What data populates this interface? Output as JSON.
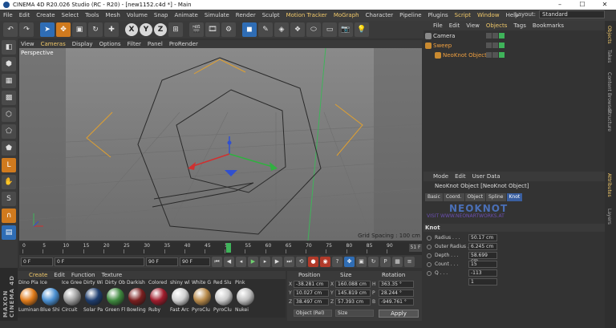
{
  "window": {
    "title": "CINEMA 4D R20.026 Studio (RC - R20) - [new1152.c4d *] - Main",
    "controls": {
      "minimize": "–",
      "maximize": "☐",
      "close": "✕"
    }
  },
  "menubar": {
    "items": [
      "File",
      "Edit",
      "Create",
      "Select",
      "Tools",
      "Mesh",
      "Volume",
      "Snap",
      "Animate",
      "Simulate",
      "Render",
      "Sculpt",
      "Motion Tracker",
      "MoGraph",
      "Character",
      "Pipeline",
      "Plugins",
      "Script",
      "Window",
      "Help"
    ],
    "layout_label": "Layout:",
    "layout_value": "Standard"
  },
  "toolbar": {
    "undo": "↶",
    "redo": "↷",
    "x": "X",
    "y": "Y",
    "z": "Z"
  },
  "viewport": {
    "menu": [
      "View",
      "Cameras",
      "Display",
      "Options",
      "Filter",
      "Panel",
      "ProRender"
    ],
    "label": "Perspective",
    "grid_spacing": "Grid Spacing : 100 cm"
  },
  "timeline": {
    "ticks": [
      "0",
      "5",
      "10",
      "15",
      "20",
      "25",
      "30",
      "35",
      "40",
      "45",
      "50",
      "55",
      "60",
      "65",
      "70",
      "75",
      "80",
      "85",
      "90"
    ],
    "playhead_frame": 51,
    "end_frame": "51 F"
  },
  "transport": {
    "start_frame": "0 F",
    "current_frame": "0 F",
    "end_field": "90 F",
    "end_field2": "90 F"
  },
  "materials": {
    "menu": [
      "Create",
      "Edit",
      "Function",
      "Texture"
    ],
    "items": [
      {
        "top": "Dino Pla",
        "bottom": "Luminan",
        "color": "#e07b1a"
      },
      {
        "top": "Ice",
        "bottom": "Blue Shi",
        "color": "#4a8fd0"
      },
      {
        "top": "Ice Gree",
        "bottom": "Circuit",
        "color": "#9c9c9c"
      },
      {
        "top": "Dirty Wi",
        "bottom": "Solar Pa",
        "color": "#1e3d6e"
      },
      {
        "top": "Dirty Ob",
        "bottom": "Green Fl",
        "color": "#3f8a3f"
      },
      {
        "top": "Darkish",
        "bottom": "Bowling",
        "color": "#7a1f1f"
      },
      {
        "top": "Colored",
        "bottom": "Ruby",
        "color": "#a01c2c"
      },
      {
        "top": "shiny wl",
        "bottom": "Fast Arc",
        "color": "#cfcfcf"
      },
      {
        "top": "White G",
        "bottom": "PyroClu",
        "color": "#b88a4a"
      },
      {
        "top": "Red Slu",
        "bottom": "PyroClu",
        "color": "#c9c9c9"
      },
      {
        "top": "Pink",
        "bottom": "Nukei",
        "color": "#bdbdbd"
      }
    ]
  },
  "coordinates": {
    "headers": {
      "position": "Position",
      "size": "Size",
      "rotation": "Rotation"
    },
    "rows": [
      {
        "axis": "X",
        "pos": "-38.281 cm",
        "size_axis": "X",
        "size": "160.088 cm",
        "rot_axis": "H",
        "rot": "363.35 °"
      },
      {
        "axis": "Y",
        "pos": "10.027 cm",
        "size_axis": "Y",
        "size": "145.819 cm",
        "rot_axis": "P",
        "rot": "28.244 °"
      },
      {
        "axis": "Z",
        "pos": "38.497 cm",
        "size_axis": "Z",
        "size": "57.393 cm",
        "rot_axis": "B",
        "rot": "-949.761 °"
      }
    ],
    "mode": "Object (Rel)",
    "size_mode": "Size",
    "apply_label": "Apply"
  },
  "objects": {
    "menu": [
      "File",
      "Edit",
      "View",
      "Objects",
      "Tags",
      "Bookmarks"
    ],
    "items": [
      {
        "name": "Camera",
        "color": "#dddddd"
      },
      {
        "name": "Sweep",
        "color": "#f0a040"
      },
      {
        "name": "NeoKnot Object",
        "color": "#f0a040"
      }
    ]
  },
  "attributes": {
    "menu": [
      "Mode",
      "Edit",
      "User Data"
    ],
    "title": "NeoKnot Object [NeoKnot Object]",
    "tabs": [
      "Basic",
      "Coord.",
      "Object",
      "Spline",
      "Knot"
    ],
    "active_tab": "Knot",
    "logo_text": "NEOKNOT",
    "logo_sub": "VISIT WWW.NEONARTWORKS.AT",
    "section": "Knot",
    "params": [
      {
        "label": "Radius",
        "value": "50.17 cm"
      },
      {
        "label": "Outer Radius",
        "value": "6.245 cm"
      },
      {
        "label": "Depth",
        "value": "58.699 cm"
      },
      {
        "label": "Count",
        "value": "15"
      },
      {
        "label": "Q",
        "value": "-113"
      },
      {
        "label": "",
        "value": "1"
      }
    ]
  },
  "right_tabs": [
    "Objects",
    "Takes",
    "Content Browser",
    "Structure",
    "Attributes",
    "Layers"
  ],
  "colors": {
    "accent": "#f0c86a",
    "selection_blue": "#2f6db5",
    "spline_orange": "#e0a030",
    "axis_green": "#3fb35a"
  }
}
